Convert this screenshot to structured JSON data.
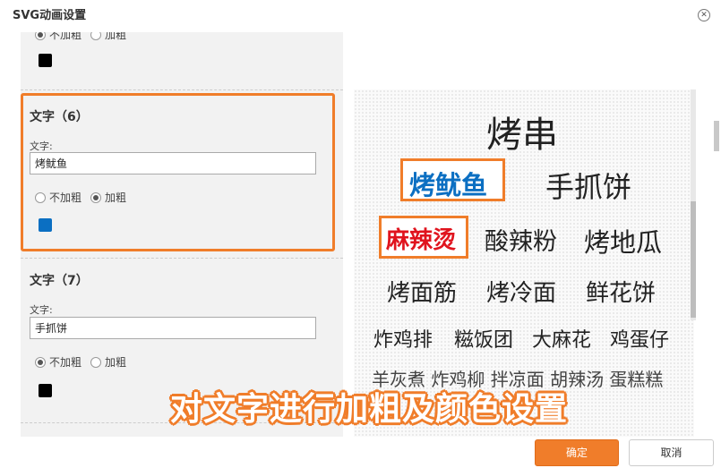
{
  "dialog": {
    "title": "SVG动画设置",
    "close_glyph": "✕"
  },
  "top_fragment": {
    "normal_label": "不加粗",
    "bold_label": "加粗",
    "color": "#000000"
  },
  "section6": {
    "title": "文字（6）",
    "field_label": "文字:",
    "value": "烤鱿鱼",
    "normal_label": "不加粗",
    "bold_label": "加粗",
    "selected": "bold",
    "color": "#0b6fc2"
  },
  "section7": {
    "title": "文字（7）",
    "field_label": "文字:",
    "value": "手抓饼",
    "normal_label": "不加粗",
    "bold_label": "加粗",
    "selected": "normal",
    "color": "#000000"
  },
  "preview": {
    "words": [
      "烤串",
      "烤鱿鱼",
      "手抓饼",
      "麻辣烫",
      "酸辣粉",
      "烤地瓜",
      "烤面筋",
      "烤冷面",
      "鲜花饼",
      "炸鸡排",
      "糍饭团",
      "大麻花",
      "鸡蛋仔"
    ],
    "partial_row": "羊灰煮  炸鸡柳  拌凉面  胡辣汤  蛋糕糕",
    "highlight_colors": {
      "blue": "#0b6fc2",
      "red": "#e0141e"
    }
  },
  "banner": "对文字进行加粗及颜色设置",
  "footer": {
    "ok_label": "确定",
    "cancel_label": "取消"
  },
  "colors": {
    "accent": "#f07d2a"
  }
}
